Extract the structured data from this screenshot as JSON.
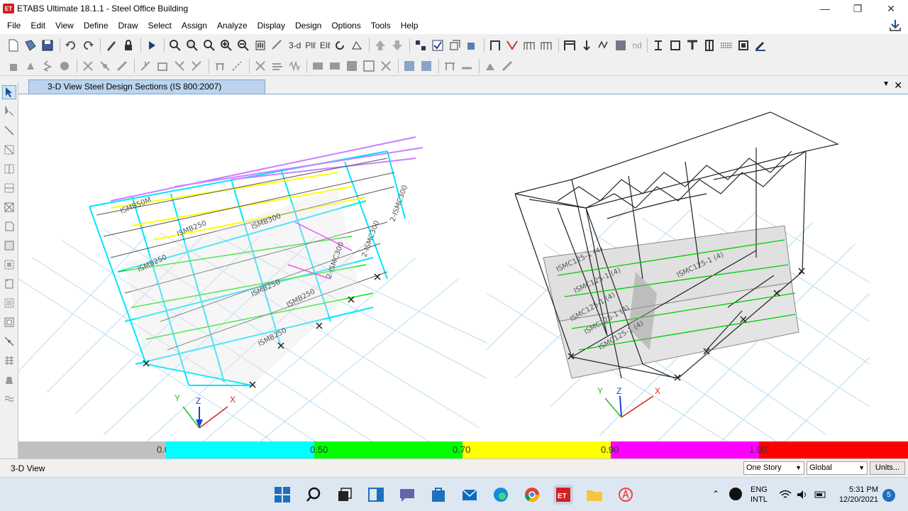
{
  "window": {
    "app_title": "ETABS Ultimate 18.1.1 - Steel Office Building",
    "logo_text": "ET"
  },
  "menu": [
    "File",
    "Edit",
    "View",
    "Define",
    "Draw",
    "Select",
    "Assign",
    "Analyze",
    "Display",
    "Design",
    "Options",
    "Tools",
    "Help"
  ],
  "toolbar": {
    "view3d_label": "3-d",
    "plan_label": "Plℓ",
    "elev_label": "Elℓ",
    "nd_label": "nd"
  },
  "view_tab": {
    "title": "3-D View  Steel Design Sections  (IS 800:2007)"
  },
  "model_left": {
    "labels": [
      "ISMB50M",
      "ISMB250",
      "ISMB300",
      "ISMB250",
      "ISMB250",
      "2-ISMC300",
      "2-ISMC300",
      "ISMB250",
      "ISMB250",
      "2-ISMC300"
    ]
  },
  "model_right": {
    "labels": [
      "ISMC125-1 (4)",
      "ISMC125-1 (4)",
      "ISMC125-1 (4)",
      "ISMC125-1 (4)",
      "ISMC125-1 (4)",
      "ISMC125-1 (4)"
    ]
  },
  "axes": {
    "x": "X",
    "y": "Y",
    "z": "Z"
  },
  "colorbar": {
    "ticks": [
      "0.00",
      "0.50",
      "0.70",
      "0.90",
      "1.00"
    ],
    "colors": [
      "#c0c0c0",
      "#00ffff",
      "#00ff00",
      "#ffff00",
      "#ff00ff",
      "#ff0000"
    ]
  },
  "status": {
    "view_name": "3-D View",
    "story_select": "One Story",
    "coord_select": "Global",
    "units_button": "Units..."
  },
  "taskbar": {
    "lang_1": "ENG",
    "lang_2": "INTL",
    "time": "5:31 PM",
    "date": "12/20/2021",
    "notifications": "5",
    "et_badge": "ET"
  }
}
